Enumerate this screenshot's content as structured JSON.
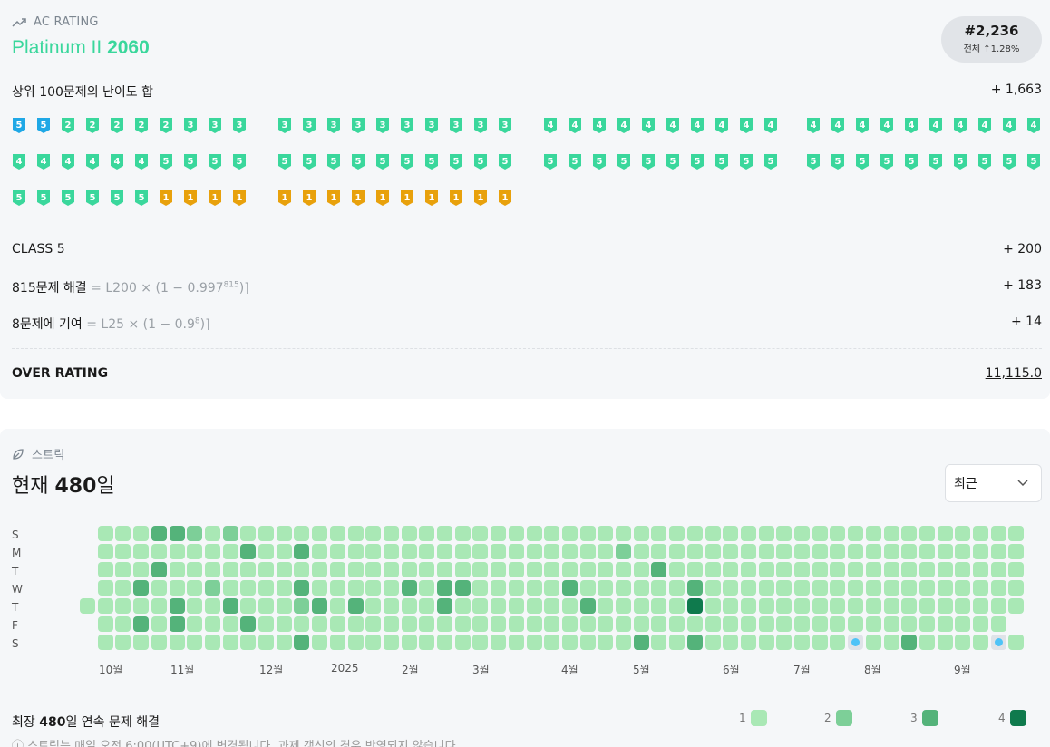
{
  "rating": {
    "section_label": "AC RATING",
    "tier_name": "Platinum II",
    "tier_value": "2060",
    "rank": "#2,236",
    "rank_sub": "전체 ↑1.28%",
    "top100_label": "상위 100문제의 난이도 합",
    "top100_value": "+ 1,663",
    "class_label": "CLASS 5",
    "class_value": "+ 200",
    "solved_label": "815문제 해결",
    "solved_formula_pre": "= L200 × (1 − 0.997",
    "solved_formula_sup": "815",
    "solved_formula_post": ")⌉",
    "solved_value": "+ 183",
    "contrib_label": "8문제에 기여",
    "contrib_formula_pre": "= L25 × (1 − 0.9",
    "contrib_formula_sup": "8",
    "contrib_formula_post": ")⌉",
    "contrib_value": "+ 14",
    "over_label": "OVER RATING",
    "over_value": "11,115.0",
    "badges": [
      [
        "5",
        "5",
        "2",
        "2",
        "2",
        "2",
        "2",
        "3",
        "3",
        "3",
        "3",
        "3",
        "3",
        "3",
        "3",
        "3",
        "3",
        "3",
        "3",
        "3",
        "4",
        "4",
        "4",
        "4",
        "4",
        "4",
        "4",
        "4",
        "4",
        "4",
        "4",
        "4",
        "4",
        "4",
        "4",
        "4",
        "4",
        "4",
        "4",
        "4"
      ],
      [
        "4",
        "4",
        "4",
        "4",
        "4",
        "4",
        "5",
        "5",
        "5",
        "5",
        "5",
        "5",
        "5",
        "5",
        "5",
        "5",
        "5",
        "5",
        "5",
        "5",
        "5",
        "5",
        "5",
        "5",
        "5",
        "5",
        "5",
        "5",
        "5",
        "5",
        "5",
        "5",
        "5",
        "5",
        "5",
        "5",
        "5",
        "5",
        "5",
        "5"
      ],
      [
        "5",
        "5",
        "5",
        "5",
        "5",
        "5",
        "1",
        "1",
        "1",
        "1",
        "1",
        "1",
        "1",
        "1",
        "1",
        "1",
        "1",
        "1",
        "1",
        "1"
      ]
    ],
    "badge_tiers": [
      [
        "diamond",
        "diamond",
        "ruby",
        "ruby",
        "ruby",
        "ruby",
        "ruby",
        "ruby",
        "ruby",
        "ruby",
        "ruby",
        "ruby",
        "ruby",
        "ruby",
        "ruby",
        "ruby",
        "ruby",
        "ruby",
        "ruby",
        "ruby",
        "ruby",
        "ruby",
        "ruby",
        "ruby",
        "ruby",
        "ruby",
        "ruby",
        "ruby",
        "ruby",
        "ruby",
        "ruby",
        "ruby",
        "ruby",
        "ruby",
        "ruby",
        "ruby",
        "ruby",
        "ruby",
        "ruby",
        "ruby"
      ],
      [
        "ruby",
        "ruby",
        "ruby",
        "ruby",
        "ruby",
        "ruby",
        "ruby",
        "ruby",
        "ruby",
        "ruby",
        "ruby",
        "ruby",
        "ruby",
        "ruby",
        "ruby",
        "ruby",
        "ruby",
        "ruby",
        "ruby",
        "ruby",
        "ruby",
        "ruby",
        "ruby",
        "ruby",
        "ruby",
        "ruby",
        "ruby",
        "ruby",
        "ruby",
        "ruby",
        "ruby",
        "ruby",
        "ruby",
        "ruby",
        "ruby",
        "ruby",
        "ruby",
        "ruby",
        "ruby",
        "ruby"
      ],
      [
        "ruby",
        "ruby",
        "ruby",
        "ruby",
        "ruby",
        "ruby",
        "gold",
        "gold",
        "gold",
        "gold",
        "gold",
        "gold",
        "gold",
        "gold",
        "gold",
        "gold",
        "gold",
        "gold",
        "gold",
        "gold"
      ]
    ],
    "colors": {
      "platinum": "#3ad79c",
      "diamond": "#1fa8e6",
      "gold": "#e8a10c"
    }
  },
  "streak": {
    "section_label": "스트릭",
    "current_prefix": "현재",
    "current_value": "480",
    "current_suffix": "일",
    "select_value": "최근",
    "days": [
      "S",
      "M",
      "T",
      "W",
      "T",
      "F",
      "S"
    ],
    "months": [
      "10월",
      "11월",
      "12월",
      "2025",
      "2월",
      "3월",
      "4월",
      "5월",
      "6월",
      "7월",
      "8월",
      "9월"
    ],
    "longest_prefix": "최장",
    "longest_value": "480",
    "longest_suffix": "일 연속 문제 해결",
    "legend": [
      "1",
      "2",
      "3",
      "4"
    ],
    "legend_colors": [
      "#a9e8b5",
      "#7dcf98",
      "#54b37a",
      "#0f7a4d"
    ],
    "note": "ⓘ 스트릭는 매일 오전 6:00(UTC+9)에 변경됩니다. 과제 갱신의 경우 반영되지 않습니다."
  }
}
